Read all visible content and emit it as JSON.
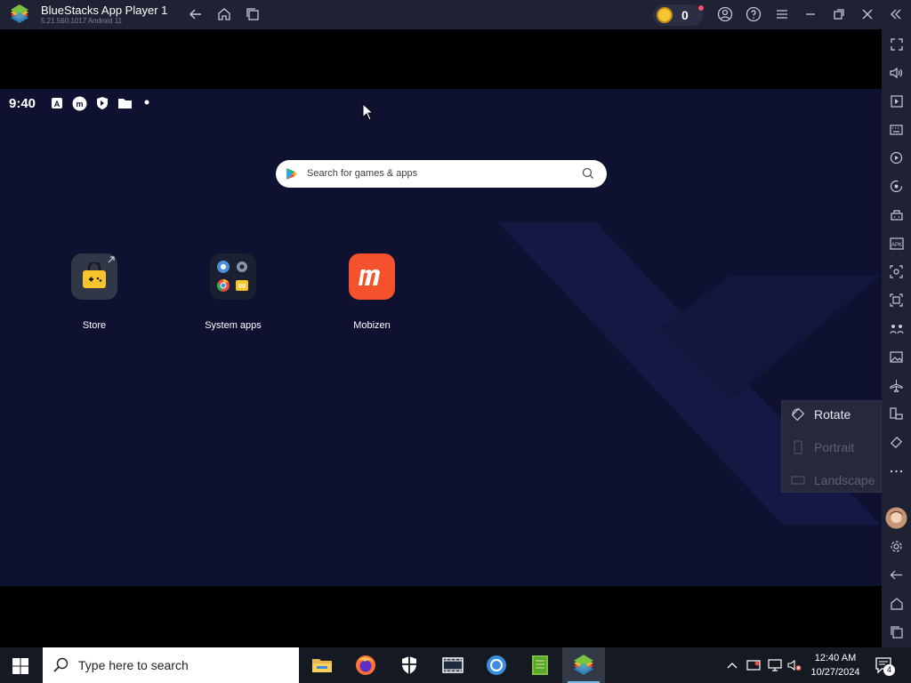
{
  "window": {
    "title": "BlueStacks App Player 1",
    "version": "5.21.560.1017 Android 11",
    "coins": "0"
  },
  "android": {
    "time": "9:40",
    "search_placeholder": "Search for games & apps",
    "apps": [
      {
        "label": "Store"
      },
      {
        "label": "System apps"
      },
      {
        "label": "Mobizen"
      }
    ]
  },
  "rotate_menu": {
    "items": [
      {
        "label": "Rotate"
      },
      {
        "label": "Portrait"
      },
      {
        "label": "Landscape"
      }
    ]
  },
  "taskbar": {
    "search_placeholder": "Type here to search",
    "time": "12:40 AM",
    "date": "10/27/2024",
    "notification_count": "4"
  },
  "colors": {
    "chrome": "#1e2233",
    "screen": "#0e1130",
    "accent_coin": "#f4c531",
    "mobizen": "#f4512c"
  }
}
